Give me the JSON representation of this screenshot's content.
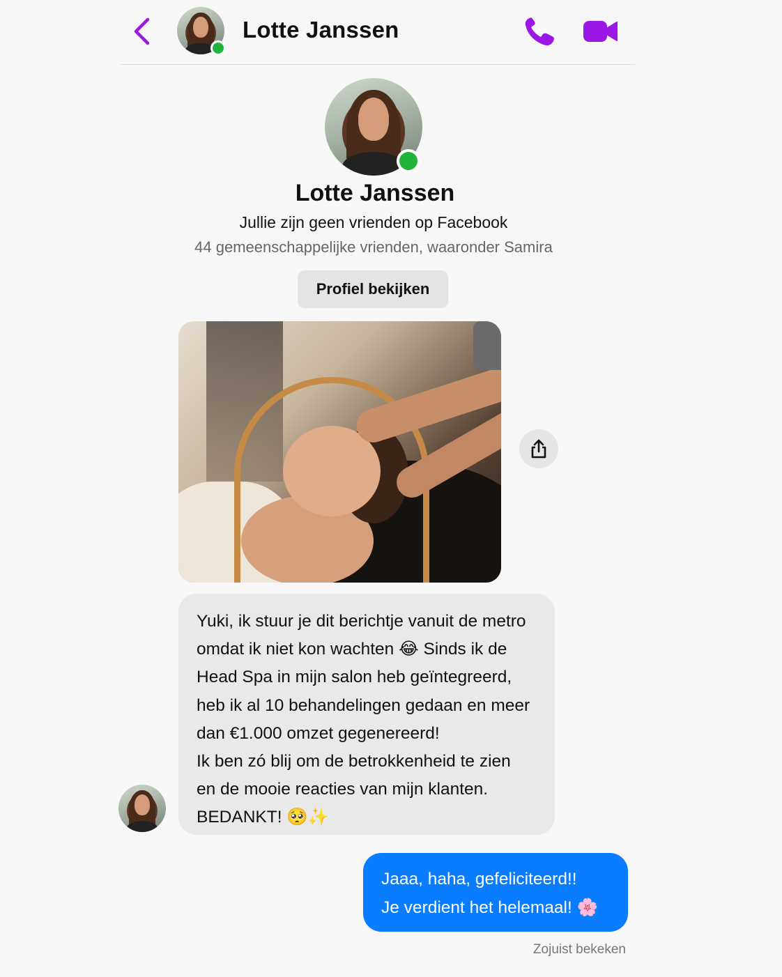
{
  "header": {
    "contact_name": "Lotte Janssen",
    "accent_color": "#9b17e6",
    "online_color": "#22b33a",
    "icons": [
      "chevron-left-icon",
      "phone-icon",
      "video-camera-icon"
    ]
  },
  "profile": {
    "name": "Lotte Janssen",
    "relation": "Jullie zijn geen vrienden op Facebook",
    "mutual_friends": "44 gemeenschappelijke vrienden, waaronder Samira",
    "view_profile_label": "Profiel bekijken"
  },
  "messages": {
    "incoming_lines": [
      "Yuki, ik stuur je dit berichtje vanuit de metro",
      "omdat ik niet kon wachten 😂 Sinds ik de",
      "Head Spa in mijn salon heb geïntegreerd,",
      "heb ik al 10 behandelingen gedaan en meer",
      "dan €1.000 omzet gegenereerd!",
      "Ik ben zó blij om de betrokkenheid te zien",
      "en de mooie reacties van mijn klanten.",
      "BEDANKT! 🥺✨"
    ],
    "outgoing_lines": [
      "Jaaa, haha, gefeliciteerd!!",
      "Je verdient het helemaal! 🌸"
    ],
    "outgoing_color": "#0a7cff",
    "seen_status": "Zojuist bekeken"
  }
}
